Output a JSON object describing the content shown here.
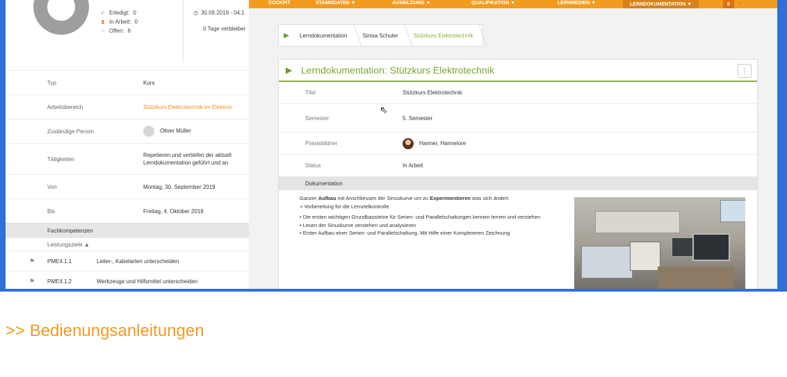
{
  "background_app": {
    "legend": [
      {
        "icon": "check-icon",
        "label": "Erledigt:",
        "value": "0"
      },
      {
        "icon": "hourglass-icon",
        "label": "In Arbeit:",
        "value": "0"
      },
      {
        "icon": "circle-icon",
        "label": "Offen:",
        "value": "6"
      }
    ],
    "date_range": "30.09.2019 - 04.1",
    "days_left": "0 Tage verbleiber",
    "rows": [
      {
        "key": "Typ",
        "value": "Kurs"
      },
      {
        "key": "Arbeitsbereich",
        "value": "Stützkurs Elektrotechnik im Elektron"
      },
      {
        "key": "Zuständige Person",
        "value": "Oliver Müller"
      },
      {
        "key": "Tätigkeiten",
        "value_line1": "Repetieren und vertiefen der aktuell",
        "value_line2": "Lerndokumentation geführt und an"
      },
      {
        "key": "Von",
        "value": "Montag, 30. September 2019"
      },
      {
        "key": "Bis",
        "value": "Freitag, 4. Oktober 2019"
      }
    ],
    "section": "Fachkompetenzen",
    "subsection": "Leistungsziele ▲",
    "items": [
      {
        "code": "PME4.1.1",
        "text": "Leiter-, Kabelarten unterscheiden"
      },
      {
        "code": "PME4.1.2",
        "text": "Werkzeuge und Hilfsmittel unterscheiden"
      }
    ]
  },
  "nav": {
    "items": [
      "COCKPIT",
      "STAMMDATEN ▼",
      "AUSBILDUNG ▼",
      "QUALIFIKATION ▼",
      "LERNMEDIEN ▼",
      "LERNDOKUMENTATION ▼"
    ],
    "badge": "0"
  },
  "breadcrumb": [
    "Lerndokumentation",
    "Sinisa Schuler",
    "Stützkurs Elektrotechnik"
  ],
  "card": {
    "title": "Lerndokumentation: Stützkurs Elektrotechnik",
    "kebab": "⋮",
    "fields": [
      {
        "key": "Titel",
        "value": "Stützkurs Elektrotechnik"
      },
      {
        "key": "Semester",
        "value": "5. Semester"
      },
      {
        "key": "Praxisbildner",
        "value": "Hanner, Hannelore"
      },
      {
        "key": "Status",
        "value": "In Arbeit"
      }
    ],
    "doc_heading": "Dokumentation",
    "doc": {
      "p1_a": "Ganzer ",
      "p1_b": "Aufbau",
      "p1_c": " mit Anschliessen der Sinuskurve um zu ",
      "p1_d": "Experimentieren",
      "p1_e": " was sich ändert",
      "p2": "+ Vorbereitung für die Lernzielkontrolle",
      "b1": "• Die ersten wichtigen Grundbausteine für Serien- und Parallelschaltungen kennen lernen und verstehen",
      "b2": "• Lesen der Sinuskurve verstehen und analysieren",
      "b3": "• Erster Aufbau einer Serien- und Parallelschaltung. Mit Hilfe einer Komplexeren Zeichnung"
    }
  },
  "footer_link": ">> Bedienungsanleitungen"
}
